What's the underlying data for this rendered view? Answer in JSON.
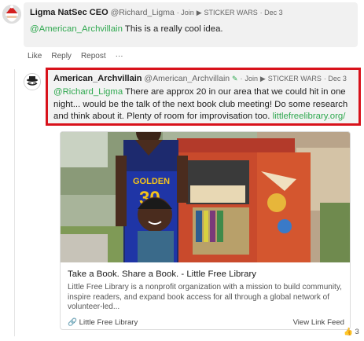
{
  "post1": {
    "author": "Ligma NatSec CEO",
    "handle": "@Richard_Ligma",
    "join": "Join",
    "group": "STICKER WARS",
    "date": "Dec 3",
    "mention": "@American_Archvillain",
    "text": " This is a really cool idea."
  },
  "actions": {
    "like": "Like",
    "reply": "Reply",
    "repost": "Repost",
    "more": "···"
  },
  "post2": {
    "author": "American_Archvillain",
    "handle": "@American_Archvillain",
    "join": "Join",
    "group": "STICKER WARS",
    "date": "Dec 3",
    "mention": "@Richard_Ligma",
    "text_line1": " There are approx 20 in our area that we could hit in one",
    "text_line2": "night... would be the talk of the next book club meeting! Do some research",
    "text_line3": "and think about it. Plenty of room for improvisation too. ",
    "link": "littlefreelibrary.org/"
  },
  "card": {
    "title": "Take a Book. Share a Book. - Little Free Library",
    "description": "Little Free Library is a nonprofit organization with a mission to build community, inspire readers, and expand book access for all through a global network of volunteer-led...",
    "source": "Little Free Library",
    "view_label": "View Link Feed",
    "link_icon": "link-icon"
  },
  "reaction": {
    "emoji": "👍",
    "count": "3"
  },
  "colors": {
    "mention": "#2fa84f",
    "highlight_border": "#d8121b"
  }
}
